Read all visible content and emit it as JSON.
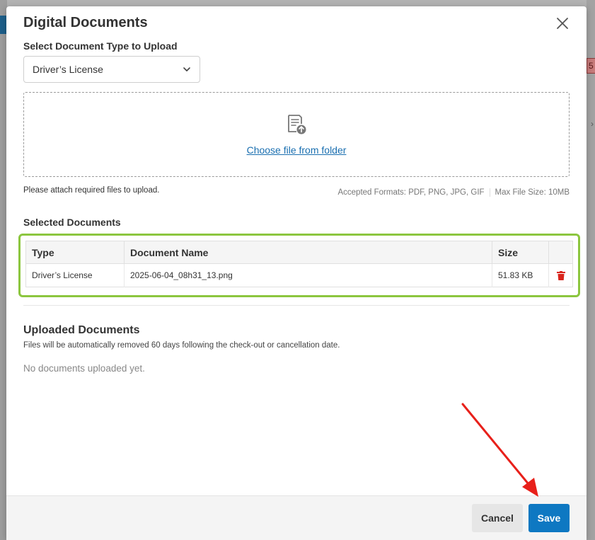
{
  "modal": {
    "title": "Digital Documents",
    "select_label": "Select Document Type to Upload",
    "document_type": "Driver’s License",
    "choose_file_link": "Choose file from folder",
    "attach_hint": "Please attach required files to upload.",
    "accepted_formats": "Accepted Formats: PDF, PNG, JPG, GIF",
    "max_file_size": "Max File Size: 10MB",
    "selected_title": "Selected Documents",
    "table": {
      "headers": [
        "Type",
        "Document Name",
        "Size"
      ],
      "rows": [
        {
          "type": "Driver’s License",
          "name": "2025-06-04_08h31_13.png",
          "size": "51.83 KB"
        }
      ]
    },
    "uploaded_title": "Uploaded Documents",
    "uploaded_subtitle": "Files will be automatically removed 60 days following the check-out or cancellation date.",
    "no_docs": "No documents uploaded yet.",
    "cancel_label": "Cancel",
    "save_label": "Save"
  },
  "background": {
    "badge_text": "5"
  },
  "icons": {
    "close": "close-icon",
    "dropdown": "chevron-down-icon",
    "upload": "file-upload-icon",
    "delete": "trash-icon"
  },
  "colors": {
    "primary": "#0e78c2",
    "link": "#1a6fb0",
    "highlight": "#8cc63f",
    "delete": "#d9251c",
    "annotation_arrow": "#e8201a"
  }
}
